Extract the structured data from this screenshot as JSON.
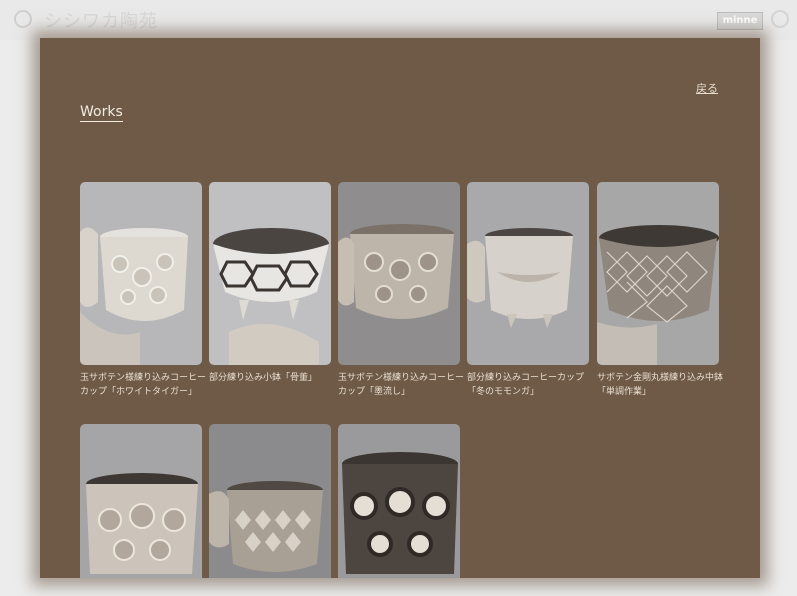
{
  "site": {
    "title": "シシワカ陶苑",
    "partner_badge": "minne"
  },
  "modal": {
    "back_label": "戻る",
    "heading": "Works"
  },
  "works": [
    {
      "caption": "玉サボテン様練り込みコーヒーカップ「ホワイトタイガー」"
    },
    {
      "caption": "部分練り込み小鉢「骨董」"
    },
    {
      "caption": "玉サボテン様練り込みコーヒーカップ「墨流し」"
    },
    {
      "caption": "部分練り込みコーヒーカップ「冬のモモンガ」"
    },
    {
      "caption": "サボテン金剛丸様練り込み中鉢「単調作業」"
    },
    {
      "caption": ""
    },
    {
      "caption": ""
    },
    {
      "caption": ""
    }
  ],
  "colors": {
    "modal_background": "#6e5a47",
    "page_background": "#ececec",
    "text_light": "#e9dfd2"
  }
}
